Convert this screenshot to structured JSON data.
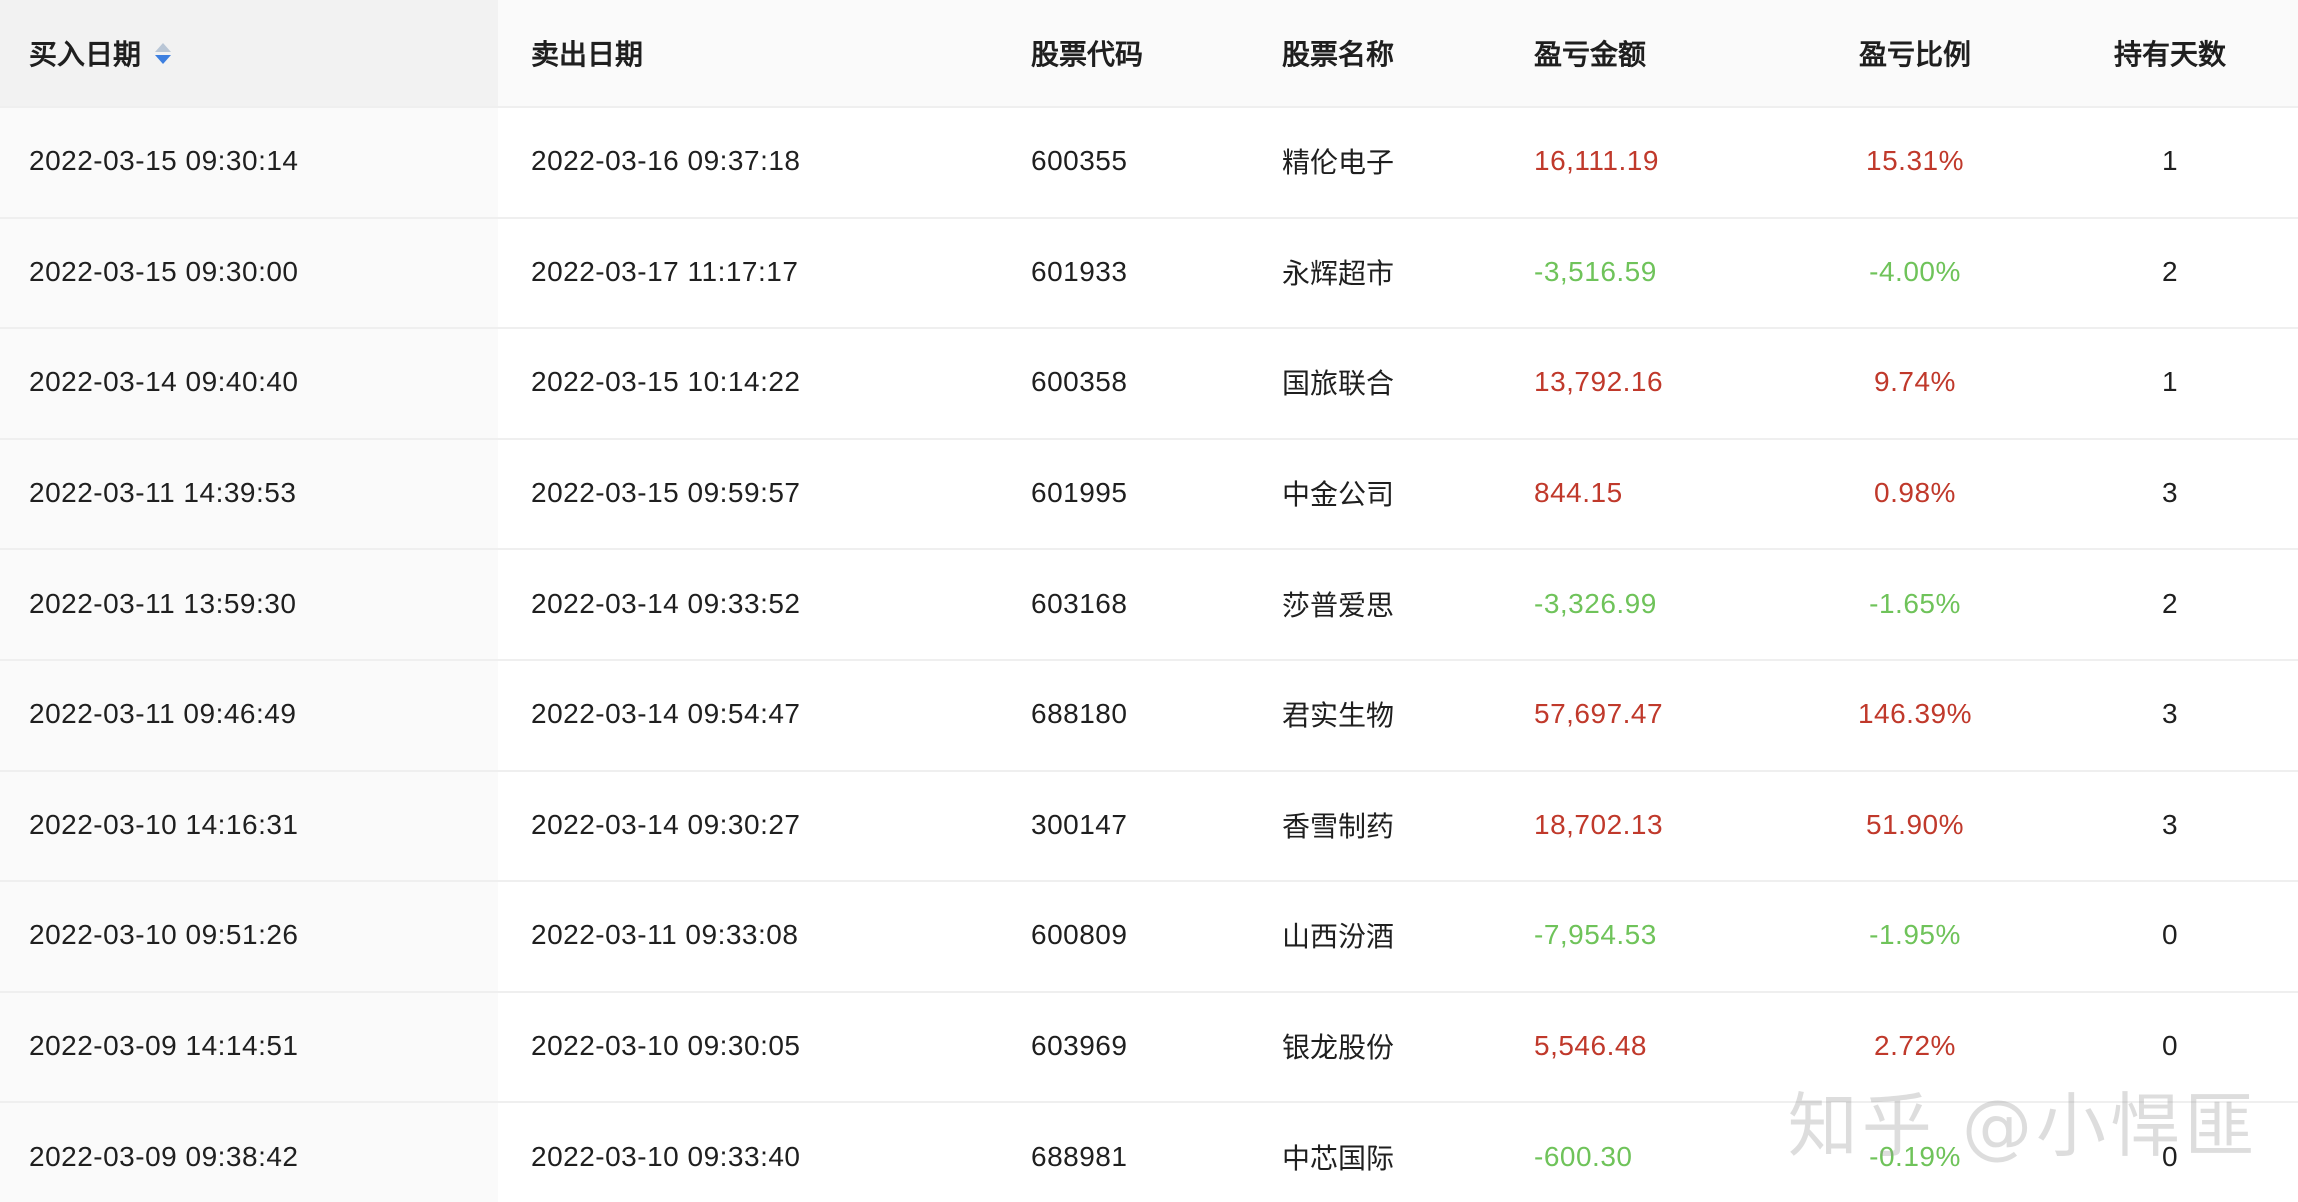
{
  "columns": [
    "买入日期",
    "卖出日期",
    "股票代码",
    "股票名称",
    "盈亏金额",
    "盈亏比例",
    "持有天数"
  ],
  "colors": {
    "profit": "#c0392b",
    "loss": "#6fc35a",
    "sort_active": "#3d7fe0"
  },
  "rows": [
    {
      "buy": "2022-03-15 09:30:14",
      "sell": "2022-03-16 09:37:18",
      "code": "600355",
      "name": "精伦电子",
      "amount": "16,111.19",
      "ratio": "15.31%",
      "days": "1",
      "dir": "pos"
    },
    {
      "buy": "2022-03-15 09:30:00",
      "sell": "2022-03-17 11:17:17",
      "code": "601933",
      "name": "永辉超市",
      "amount": "-3,516.59",
      "ratio": "-4.00%",
      "days": "2",
      "dir": "neg"
    },
    {
      "buy": "2022-03-14 09:40:40",
      "sell": "2022-03-15 10:14:22",
      "code": "600358",
      "name": "国旅联合",
      "amount": "13,792.16",
      "ratio": "9.74%",
      "days": "1",
      "dir": "pos"
    },
    {
      "buy": "2022-03-11 14:39:53",
      "sell": "2022-03-15 09:59:57",
      "code": "601995",
      "name": "中金公司",
      "amount": "844.15",
      "ratio": "0.98%",
      "days": "3",
      "dir": "pos"
    },
    {
      "buy": "2022-03-11 13:59:30",
      "sell": "2022-03-14 09:33:52",
      "code": "603168",
      "name": "莎普爱思",
      "amount": "-3,326.99",
      "ratio": "-1.65%",
      "days": "2",
      "dir": "neg"
    },
    {
      "buy": "2022-03-11 09:46:49",
      "sell": "2022-03-14 09:54:47",
      "code": "688180",
      "name": "君实生物",
      "amount": "57,697.47",
      "ratio": "146.39%",
      "days": "3",
      "dir": "pos"
    },
    {
      "buy": "2022-03-10 14:16:31",
      "sell": "2022-03-14 09:30:27",
      "code": "300147",
      "name": "香雪制药",
      "amount": "18,702.13",
      "ratio": "51.90%",
      "days": "3",
      "dir": "pos"
    },
    {
      "buy": "2022-03-10 09:51:26",
      "sell": "2022-03-11 09:33:08",
      "code": "600809",
      "name": "山西汾酒",
      "amount": "-7,954.53",
      "ratio": "-1.95%",
      "days": "0",
      "dir": "neg"
    },
    {
      "buy": "2022-03-09 14:14:51",
      "sell": "2022-03-10 09:30:05",
      "code": "603969",
      "name": "银龙股份",
      "amount": "5,546.48",
      "ratio": "2.72%",
      "days": "0",
      "dir": "pos"
    },
    {
      "buy": "2022-03-09 09:38:42",
      "sell": "2022-03-10 09:33:40",
      "code": "688981",
      "name": "中芯国际",
      "amount": "-600.30",
      "ratio": "-0.19%",
      "days": "0",
      "dir": "neg"
    }
  ],
  "watermark": "知乎 @小悍匪"
}
